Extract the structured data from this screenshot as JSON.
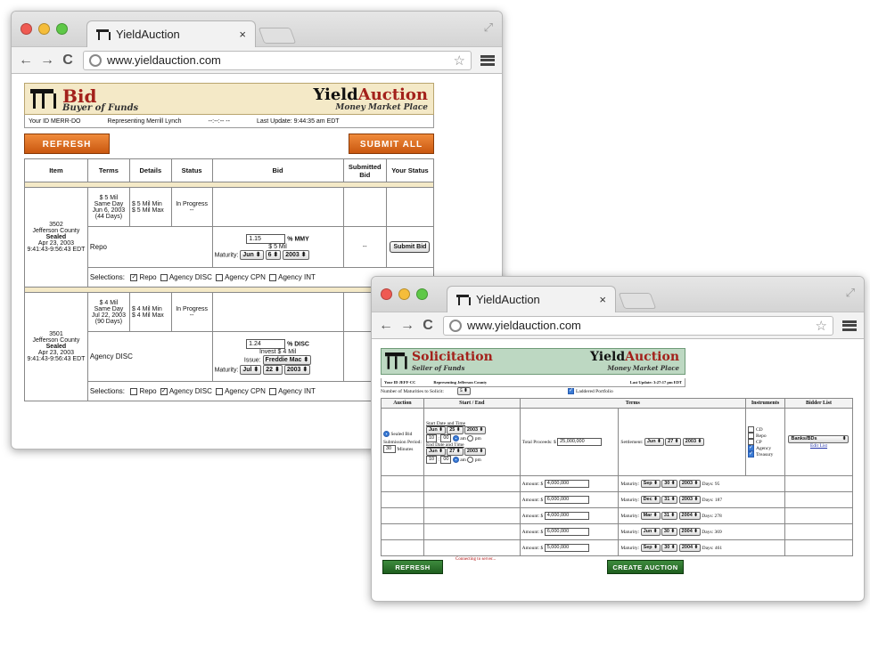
{
  "browser": {
    "tab_title": "YieldAuction",
    "close_glyph": "×",
    "url": "www.yieldauction.com",
    "back_glyph": "←",
    "forward_glyph": "→",
    "reload_glyph": "C",
    "star_glyph": "☆"
  },
  "bid_page": {
    "banner": {
      "title": "Bid",
      "subtitle": "Buyer of Funds",
      "brand_a": "Yield",
      "brand_b": "Auction",
      "brand_sub": "Money Market Place"
    },
    "info": {
      "your_id": "Your ID  MERR-DO",
      "representing": "Representing  Merrill Lynch",
      "dashes": "--:--:-- --",
      "last_update": "Last Update: 9:44:35 am EDT"
    },
    "refresh_label": "REFRESH",
    "submit_all_label": "SUBMIT ALL",
    "columns": [
      "Item",
      "Terms",
      "Details",
      "Status",
      "Bid",
      "Submitted Bid",
      "Your Status"
    ],
    "auctions": [
      {
        "item": [
          "3502",
          "Jefferson County",
          "Sealed",
          "Apr 23, 2003",
          "9:41:43-9:56:43 EDT"
        ],
        "terms": [
          "$ 5 Mil",
          "Same Day",
          "Jun 6, 2003",
          "(44 Days)"
        ],
        "details": [
          "$ 5 Mil Min",
          "$ 5 Mil Max"
        ],
        "status": [
          "In Progress",
          "--"
        ],
        "product": "Repo",
        "rate_value": "1.15",
        "rate_unit": "% MMY",
        "amount": "$ 5 Mil",
        "maturity_label": "Maturity:",
        "maturity": [
          "Jun",
          "6",
          "2003"
        ],
        "submitted": "--",
        "submit_bid_label": "Submit Bid",
        "selections_label": "Selections:",
        "selections": [
          {
            "label": "Repo",
            "checked": true
          },
          {
            "label": "Agency DISC",
            "checked": false
          },
          {
            "label": "Agency CPN",
            "checked": false
          },
          {
            "label": "Agency INT",
            "checked": false
          }
        ]
      },
      {
        "item": [
          "3501",
          "Jefferson County",
          "Sealed",
          "Apr 23, 2003",
          "9:41:43-9:56:43 EDT"
        ],
        "terms": [
          "$ 4 Mil",
          "Same Day",
          "Jul 22, 2003",
          "(90 Days)"
        ],
        "details": [
          "$ 4 Mil Min",
          "$ 4 Mil Max"
        ],
        "status": [
          "In Progress",
          "--"
        ],
        "product": "Agency DISC",
        "rate_value": "1.24",
        "rate_unit": "% DISC",
        "amount": "Invest $ 4 Mil",
        "issue_label": "Issue:",
        "issue": "Freddie Mac",
        "maturity_label": "Maturity:",
        "maturity": [
          "Jul",
          "22",
          "2003"
        ],
        "selections_label": "Selections:",
        "selections": [
          {
            "label": "Repo",
            "checked": false
          },
          {
            "label": "Agency DISC",
            "checked": true
          },
          {
            "label": "Agency CPN",
            "checked": false
          },
          {
            "label": "Agency INT",
            "checked": false
          }
        ]
      }
    ]
  },
  "solicitation_page": {
    "banner": {
      "title": "Solicitation",
      "subtitle": "Seller of Funds",
      "brand_a": "Yield",
      "brand_b": "Auction",
      "brand_sub": "Money Market Place"
    },
    "info": {
      "your_id": "Your ID  JEFF-CC",
      "representing": "Representing  Jefferson County",
      "last_update": "Last Update: 3:27:17 pm EDT"
    },
    "maturities_label": "Number of Maturities to Solicit:",
    "maturities_value": "5",
    "laddered_label": "Laddered Portfolio",
    "columns": [
      "Auction",
      "Start / End",
      "Terms",
      "Instruments",
      "Bidder List"
    ],
    "auction_type": "Sealed Bid",
    "submission_label": "Submission Period:",
    "submission_value": "30",
    "minutes_label": "Minutes",
    "start_label": "Start Date and Time",
    "start_date": [
      "Jun",
      "25",
      "2003"
    ],
    "start_time": [
      "10",
      "00"
    ],
    "end_label": "End Date and Time",
    "end_date": [
      "Jun",
      "27",
      "2003"
    ],
    "end_time": [
      "10",
      "00"
    ],
    "am": "am",
    "pm": "pm",
    "total_label": "Total Proceeds: $",
    "total_value": "25,000,000",
    "settlement_label": "Settlement:",
    "settlement": [
      "Jun",
      "27",
      "2003"
    ],
    "instruments": [
      {
        "label": "CD",
        "checked": false
      },
      {
        "label": "Repo",
        "checked": false
      },
      {
        "label": "CP",
        "checked": false
      },
      {
        "label": "Agency",
        "checked": true
      },
      {
        "label": "Treasury",
        "checked": true
      }
    ],
    "bidder_list": "Banks/BDs",
    "edit_list": "Edit List",
    "amount_label": "Amount: $",
    "maturity_label": "Maturity:",
    "days_label": "Days:",
    "rows": [
      {
        "amount": "4,000,000",
        "maturity": [
          "Sep",
          "30",
          "2003"
        ],
        "days": "95"
      },
      {
        "amount": "6,000,000",
        "maturity": [
          "Dec",
          "31",
          "2003"
        ],
        "days": "187"
      },
      {
        "amount": "4,000,000",
        "maturity": [
          "Mar",
          "31",
          "2004"
        ],
        "days": "278"
      },
      {
        "amount": "6,000,000",
        "maturity": [
          "Jun",
          "30",
          "2004"
        ],
        "days": "369"
      },
      {
        "amount": "5,000,000",
        "maturity": [
          "Sep",
          "30",
          "2004"
        ],
        "days": "461"
      }
    ],
    "refresh_label": "REFRESH",
    "connecting": "Connecting to server...",
    "create_label": "CREATE AUCTION"
  }
}
